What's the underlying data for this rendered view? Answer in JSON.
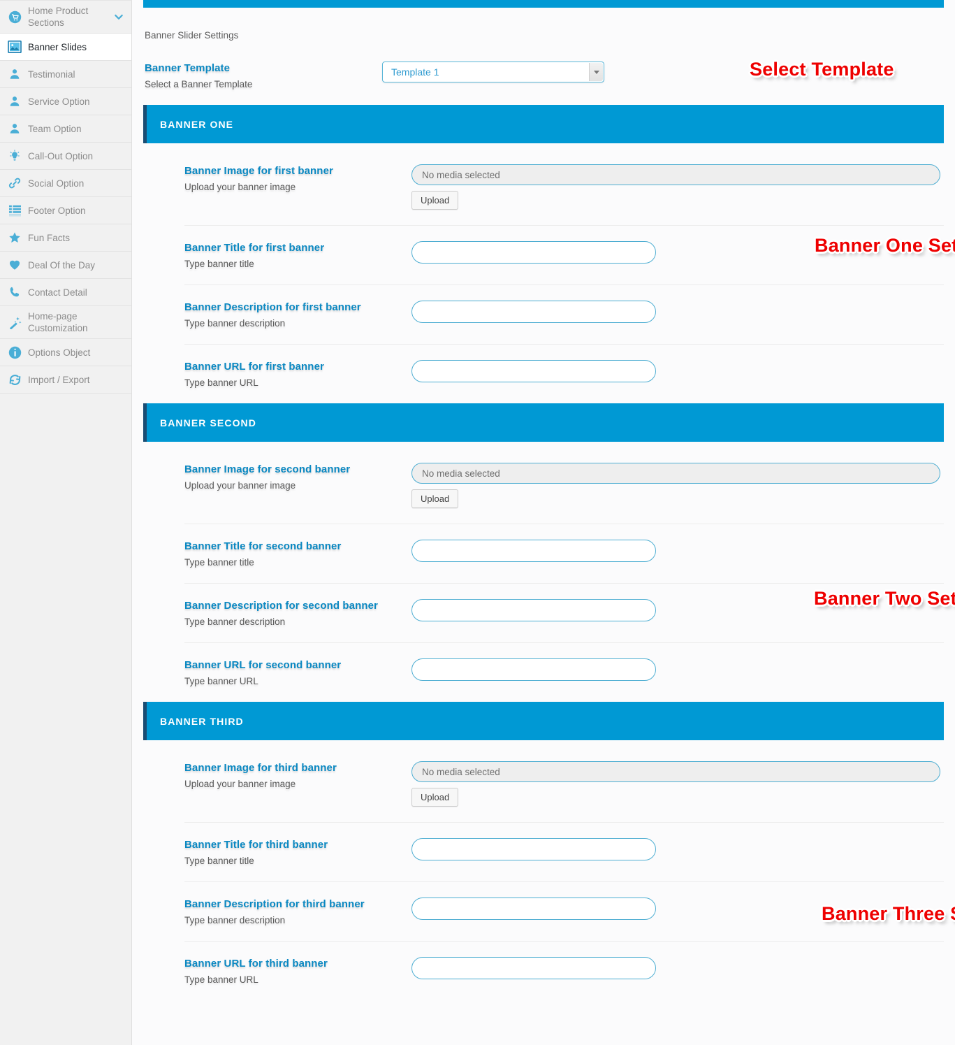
{
  "sidebar": {
    "items": [
      {
        "label": "Home Product Sections",
        "icon": "cart-icon",
        "active": false,
        "chevron": true
      },
      {
        "label": "Banner Slides",
        "icon": "image-icon",
        "active": true,
        "chevron": false
      },
      {
        "label": "Testimonial",
        "icon": "user-icon",
        "active": false,
        "chevron": false
      },
      {
        "label": "Service Option",
        "icon": "user-icon",
        "active": false,
        "chevron": false
      },
      {
        "label": "Team Option",
        "icon": "user-icon",
        "active": false,
        "chevron": false
      },
      {
        "label": "Call-Out Option",
        "icon": "lightbulb-icon",
        "active": false,
        "chevron": false
      },
      {
        "label": "Social Option",
        "icon": "link-icon",
        "active": false,
        "chevron": false
      },
      {
        "label": "Footer Option",
        "icon": "list-icon",
        "active": false,
        "chevron": false
      },
      {
        "label": "Fun Facts",
        "icon": "star-icon",
        "active": false,
        "chevron": false
      },
      {
        "label": "Deal Of the Day",
        "icon": "heart-icon",
        "active": false,
        "chevron": false
      },
      {
        "label": "Contact Detail",
        "icon": "phone-icon",
        "active": false,
        "chevron": false
      },
      {
        "label": "Home-page Customization",
        "icon": "magic-wand-icon",
        "active": false,
        "chevron": false
      },
      {
        "label": "Options Object",
        "icon": "info-icon",
        "active": false,
        "chevron": false
      },
      {
        "label": "Import / Export",
        "icon": "sync-icon",
        "active": false,
        "chevron": false
      }
    ]
  },
  "main": {
    "page_subtitle": "Banner Slider Settings",
    "template_field": {
      "label": "Banner Template",
      "description": "Select a Banner Template",
      "selected": "Template 1",
      "options": [
        "Template 1"
      ]
    },
    "upload_button_label": "Upload",
    "media_placeholder": "No media selected",
    "sections": [
      {
        "title": "BANNER ONE",
        "rows": [
          {
            "label": "Banner Image for first banner",
            "description": "Upload your banner image",
            "type": "media",
            "value": ""
          },
          {
            "label": "Banner Title for first banner",
            "description": "Type banner title",
            "type": "text",
            "value": ""
          },
          {
            "label": "Banner Description for first banner",
            "description": "Type banner description",
            "type": "text",
            "value": ""
          },
          {
            "label": "Banner URL for first banner",
            "description": "Type banner URL",
            "type": "text",
            "value": ""
          }
        ]
      },
      {
        "title": "BANNER SECOND",
        "rows": [
          {
            "label": "Banner Image for second banner",
            "description": "Upload your banner image",
            "type": "media",
            "value": ""
          },
          {
            "label": "Banner Title for second banner",
            "description": "Type banner title",
            "type": "text",
            "value": ""
          },
          {
            "label": "Banner Description for second banner",
            "description": "Type banner description",
            "type": "text",
            "value": ""
          },
          {
            "label": "Banner URL for second banner",
            "description": "Type banner URL",
            "type": "text",
            "value": ""
          }
        ]
      },
      {
        "title": "BANNER THIRD",
        "rows": [
          {
            "label": "Banner Image for third banner",
            "description": "Upload your banner image",
            "type": "media",
            "value": ""
          },
          {
            "label": "Banner Title for third banner",
            "description": "Type banner title",
            "type": "text",
            "value": ""
          },
          {
            "label": "Banner Description for third banner",
            "description": "Type banner description",
            "type": "text",
            "value": ""
          },
          {
            "label": "Banner URL for third banner",
            "description": "Type banner URL",
            "type": "text",
            "value": ""
          }
        ]
      }
    ]
  },
  "annotations": {
    "select_template": "Select Template",
    "banner_one": "Banner One Setting",
    "banner_two": "Banner Two Setting",
    "banner_three": "Banner Three Setting"
  },
  "colors": {
    "accent_blue": "#0099d4",
    "label_blue": "#0a88c2",
    "header_left_border": "#1a4d73",
    "annotation_red": "#ee0000",
    "sidebar_bg": "#f1f1f1"
  }
}
